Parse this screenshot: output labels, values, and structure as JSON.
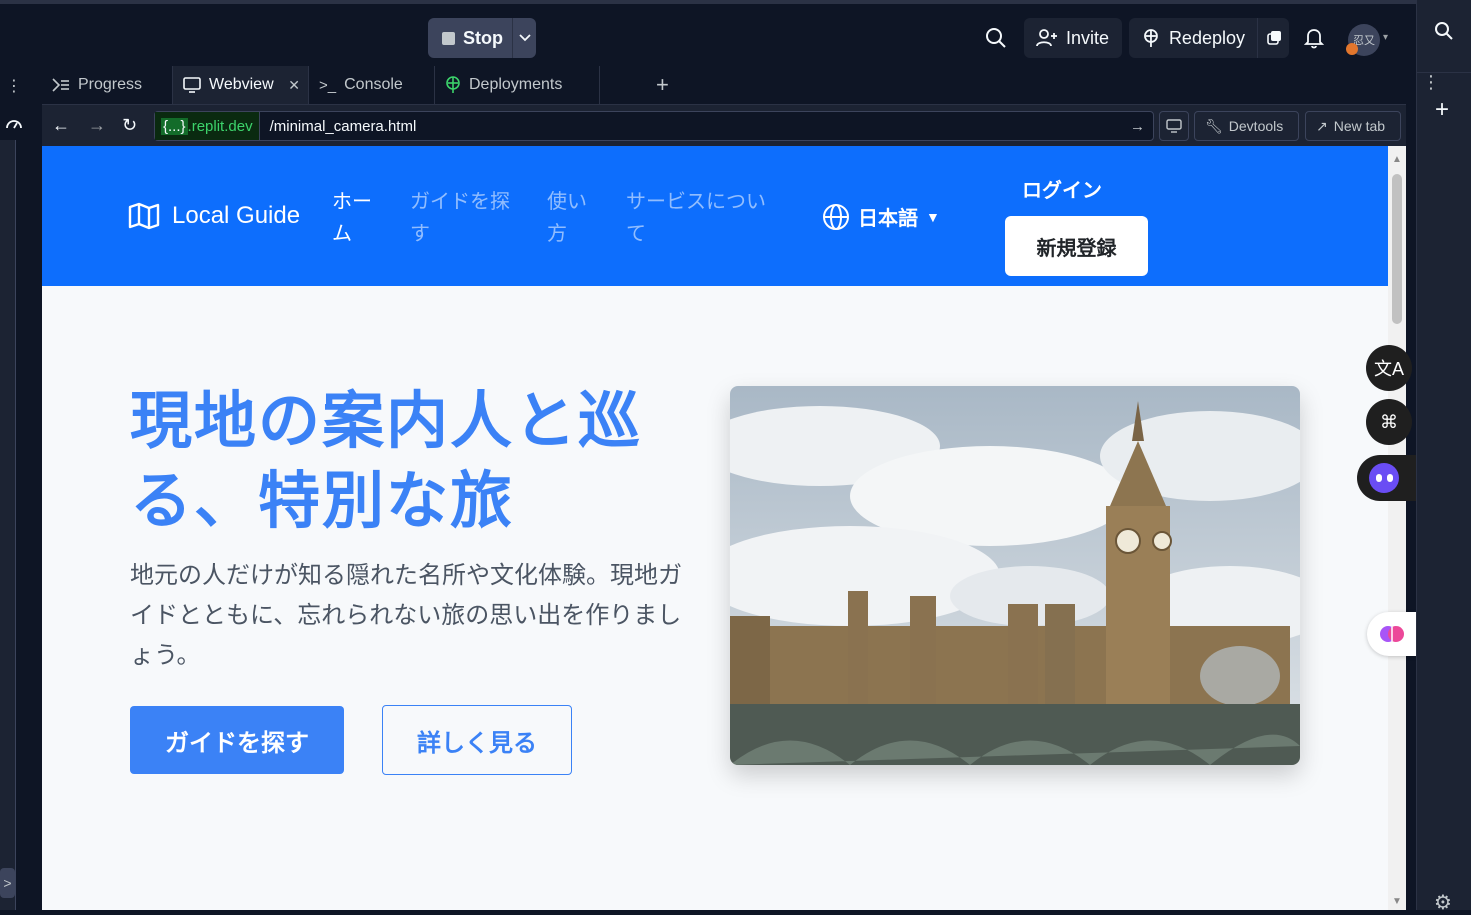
{
  "topbar": {
    "stop_label": "Stop",
    "invite_label": "Invite",
    "redeploy_label": "Redeploy",
    "avatar_text": "忍又"
  },
  "tabs": [
    {
      "label": "Progress",
      "icon": "progress-icon"
    },
    {
      "label": "Webview",
      "icon": "monitor-icon",
      "active": true
    },
    {
      "label": "Console",
      "icon": "terminal-icon"
    },
    {
      "label": "Deployments",
      "icon": "deployments-icon"
    }
  ],
  "urlbar": {
    "host_prefix": "{...}",
    "host_suffix": ".replit.dev",
    "path": "/minimal_camera.html",
    "devtools_label": "Devtools",
    "newtab_label": "New tab"
  },
  "site": {
    "brand": "Local Guide",
    "nav": [
      {
        "label": "ホー\nム",
        "active": true
      },
      {
        "label": "ガイドを探\nす"
      },
      {
        "label": "使い\n方"
      },
      {
        "label": "サービスについ\nて"
      }
    ],
    "language": "日本語",
    "login": "ログイン",
    "signup": "新規登録",
    "hero_title": "現地の案内人と巡る、特別な旅",
    "hero_subtitle": "地元の人だけが知る隠れた名所や文化体験。現地ガイドとともに、忘れられない旅の思い出を作りましょう。",
    "primary_cta": "ガイドを探す",
    "secondary_cta": "詳しく見る"
  },
  "colors": {
    "header_blue": "#0d6efd",
    "accent_blue": "#3b82f6",
    "ide_bg": "#0e1525"
  }
}
